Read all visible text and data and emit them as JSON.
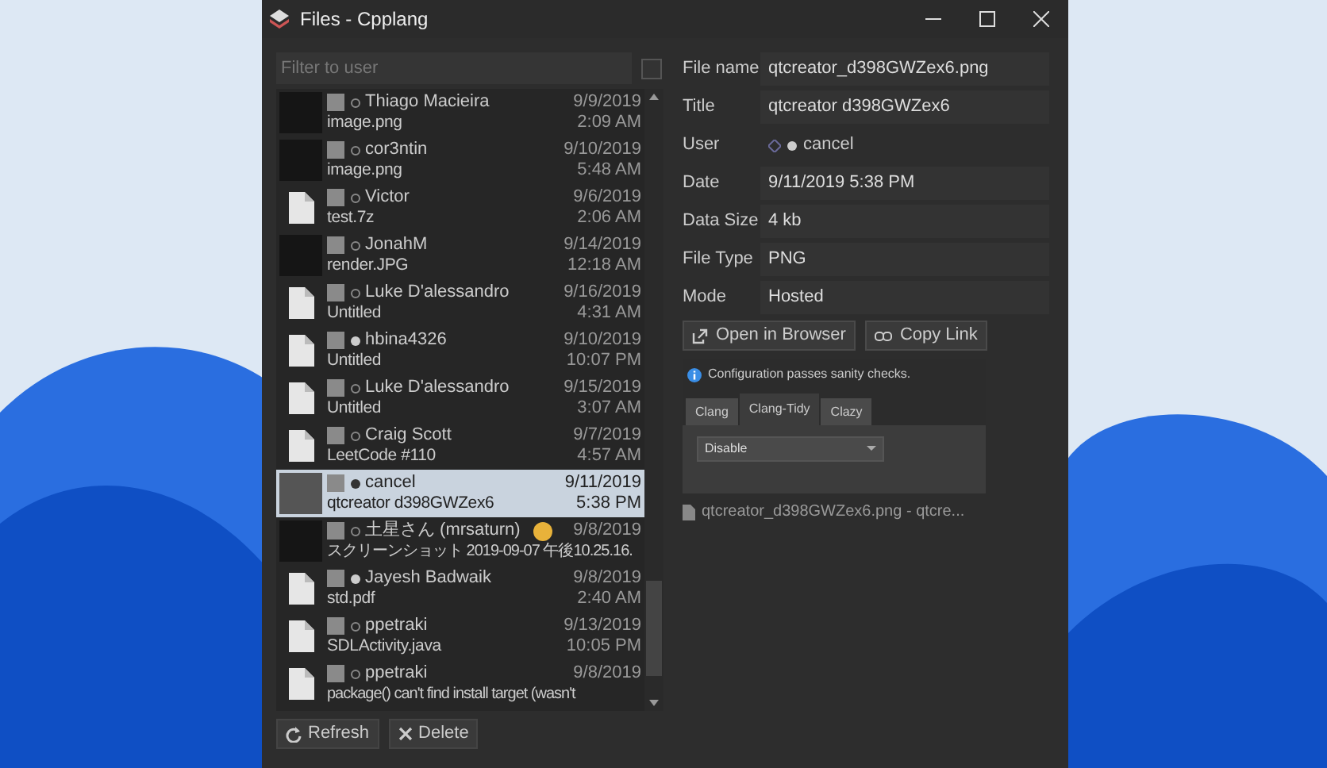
{
  "window": {
    "title": "Files - Cpplang"
  },
  "filter": {
    "placeholder": "Filter to user",
    "checked": false
  },
  "files": [
    {
      "kind": "image",
      "user": "Thiago Macieira",
      "online": false,
      "name": "image.png",
      "date": "9/9/2019",
      "time": "2:09 AM",
      "selected": false
    },
    {
      "kind": "image",
      "user": "cor3ntin",
      "online": false,
      "name": "image.png",
      "date": "9/10/2019",
      "time": "5:48 AM",
      "selected": false
    },
    {
      "kind": "file",
      "user": "Victor",
      "online": false,
      "name": "test.7z",
      "date": "9/6/2019",
      "time": "2:06 AM",
      "selected": false
    },
    {
      "kind": "image",
      "user": "JonahM",
      "online": false,
      "name": "render.JPG",
      "date": "9/14/2019",
      "time": "12:18 AM",
      "selected": false
    },
    {
      "kind": "file",
      "user": "Luke D'alessandro",
      "online": false,
      "name": "Untitled",
      "date": "9/16/2019",
      "time": "4:31 AM",
      "selected": false
    },
    {
      "kind": "file",
      "user": "hbina4326",
      "online": true,
      "name": "Untitled",
      "date": "9/10/2019",
      "time": "10:07 PM",
      "selected": false
    },
    {
      "kind": "file",
      "user": "Luke D'alessandro",
      "online": false,
      "name": "Untitled",
      "date": "9/15/2019",
      "time": "3:07 AM",
      "selected": false
    },
    {
      "kind": "file",
      "user": "Craig Scott",
      "online": false,
      "name": "LeetCode #110",
      "date": "9/7/2019",
      "time": "4:57 AM",
      "selected": false
    },
    {
      "kind": "image",
      "user": "cancel",
      "online": true,
      "name": "qtcreator d398GWZex6",
      "date": "9/11/2019",
      "time": "5:38 PM",
      "selected": true
    },
    {
      "kind": "image",
      "user": "土星さん (mrsaturn)",
      "online": false,
      "emoji": true,
      "name": "スクリーンショット 2019-09-07 午後10.25.16.",
      "date": "9/8/2019",
      "selected": false
    },
    {
      "kind": "file",
      "user": "Jayesh Badwaik",
      "online": true,
      "name": "std.pdf",
      "date": "9/8/2019",
      "time": "2:40 AM",
      "selected": false
    },
    {
      "kind": "file",
      "user": "ppetraki",
      "online": false,
      "name": "SDLActivity.java",
      "date": "9/13/2019",
      "time": "10:05 PM",
      "selected": false
    },
    {
      "kind": "file",
      "user": "ppetraki",
      "online": false,
      "name": "package() can't find install target (wasn't",
      "date": "9/8/2019",
      "selected": false
    }
  ],
  "buttons": [
    "Refresh",
    "Delete"
  ],
  "details": [
    {
      "kind": "field",
      "label": "File name",
      "value": "qtcreator_d398GWZex6.png"
    },
    {
      "kind": "field",
      "label": "Title",
      "value": "qtcreator d398GWZex6"
    },
    {
      "kind": "user",
      "label": "User",
      "value": "cancel",
      "online": true
    },
    {
      "kind": "field",
      "label": "Date",
      "value": "9/11/2019 5:38 PM"
    },
    {
      "kind": "field",
      "label": "Data Size",
      "value": "4 kb"
    },
    {
      "kind": "field",
      "label": "File Type",
      "value": "PNG"
    },
    {
      "kind": "field",
      "label": "Mode",
      "value": "Hosted"
    }
  ],
  "actions": [
    "Open in Browser",
    "Copy Link"
  ],
  "preview": {
    "message": "Configuration passes sanity checks.",
    "tabs": [
      {
        "label": "Clang",
        "selected": false
      },
      {
        "label": "Clang-Tidy",
        "selected": true
      },
      {
        "label": "Clazy",
        "selected": false
      }
    ],
    "dropdown": "Disable",
    "caption": "qtcreator_d398GWZex6.png - qtcre..."
  }
}
